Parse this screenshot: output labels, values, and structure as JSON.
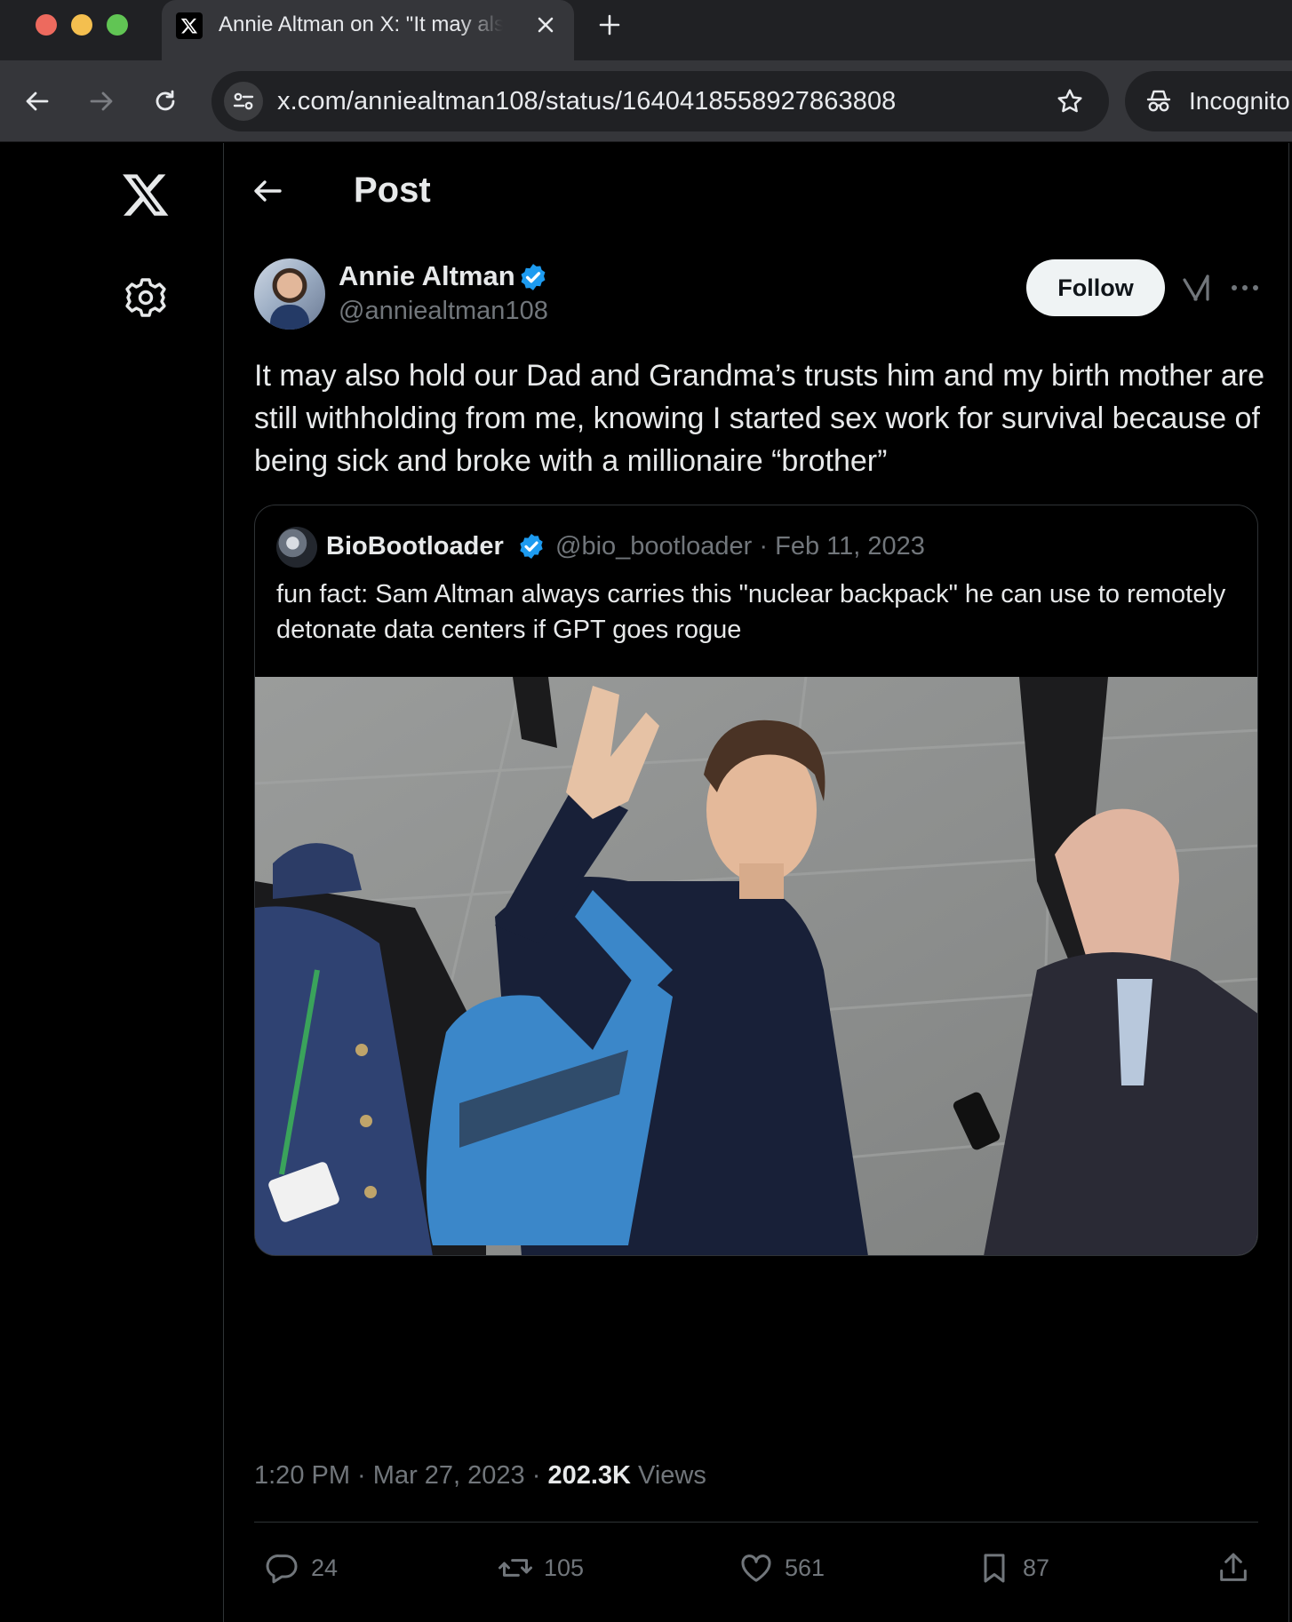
{
  "browser": {
    "tab_title": "Annie Altman on X: \"It may also hold our Dad and Grandma's trusts",
    "url": "x.com/anniealtman108/status/1640418558927863808",
    "incognito_label": "Incognito"
  },
  "header": {
    "title": "Post"
  },
  "post": {
    "display_name": "Annie Altman",
    "handle": "@anniealtman108",
    "follow_label": "Follow",
    "text": "It may also hold our Dad and Grandma’s trusts him and my birth mother are still withholding from me, knowing I started sex work for survival because of being sick and broke with a millionaire “brother”",
    "time": "1:20 PM",
    "date": "Mar 27, 2023",
    "views_count": "202.3K",
    "views_label": "Views",
    "replies": "24",
    "reposts": "105",
    "likes": "561",
    "bookmarks": "87"
  },
  "quote": {
    "display_name": "BioBootloader",
    "handle": "@bio_bootloader",
    "date": "Feb 11, 2023",
    "text": "fun fact: Sam Altman always carries this \"nuclear backpack\" he can use to remotely detonate data centers if GPT goes rogue"
  },
  "icons": {
    "tab_favicon": "x-logo-icon",
    "back": "arrow-left-icon",
    "forward": "arrow-right-icon",
    "reload": "reload-icon",
    "site_info": "tune-icon",
    "bookmark_star": "star-icon",
    "incognito": "incognito-icon",
    "logo": "x-logo-icon",
    "settings": "gear-icon",
    "verified": "verified-badge-icon",
    "grok": "grok-icon",
    "more": "more-icon",
    "reply": "reply-icon",
    "repost": "repost-icon",
    "like": "heart-icon",
    "bookmark": "bookmark-icon",
    "share": "share-icon"
  },
  "colors": {
    "background": "#000000",
    "text_primary": "#e7e9ea",
    "text_secondary": "#71767b",
    "verified_blue": "#1d9bf0",
    "border": "#2f3336",
    "chrome_tabbar": "#202124",
    "chrome_toolbar": "#35363a"
  }
}
